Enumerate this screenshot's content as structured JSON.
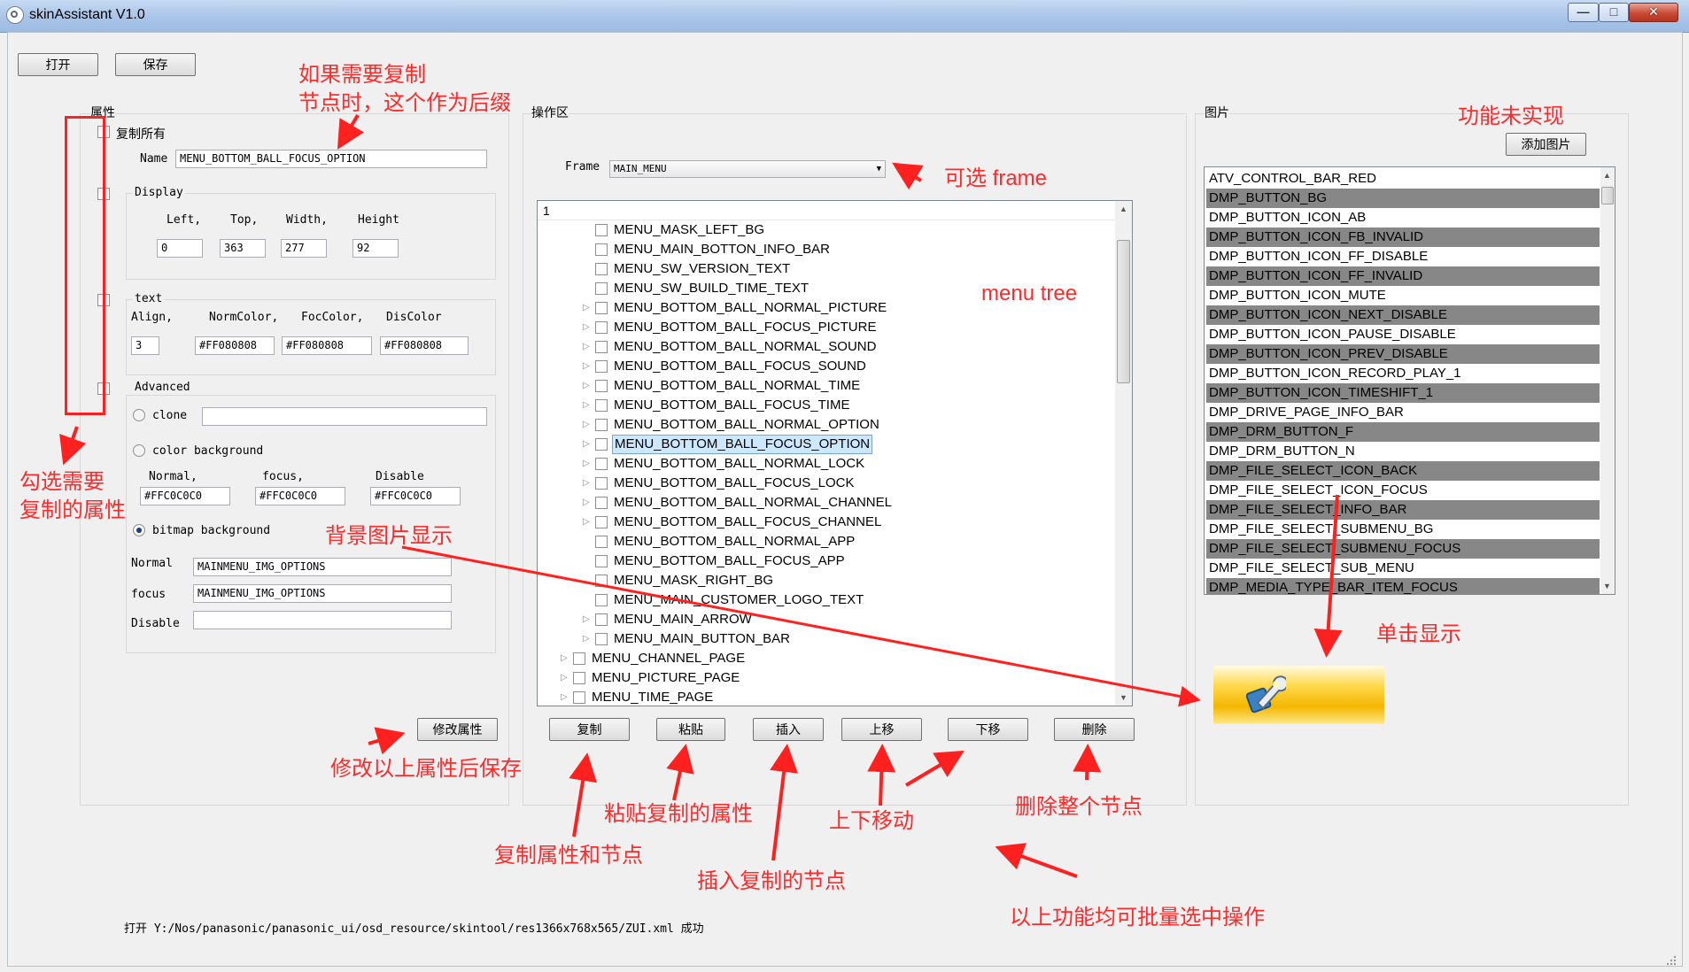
{
  "window": {
    "title": "skinAssistant V1.0",
    "minimize_glyph": "—",
    "maximize_glyph": "□",
    "close_glyph": "✕"
  },
  "toolbar": {
    "open_label": "打开",
    "save_label": "保存"
  },
  "properties": {
    "group_title": "属性",
    "copy_all_label": "复制所有",
    "name_label": "Name",
    "name_value": "MENU_BOTTOM_BALL_FOCUS_OPTION",
    "display": {
      "title": "Display",
      "left_label": "Left,",
      "top_label": "Top,",
      "width_label": "Width,",
      "height_label": "Height",
      "left_value": "0",
      "top_value": "363",
      "width_value": "277",
      "height_value": "92"
    },
    "text": {
      "title": "text",
      "align_label": "Align,",
      "normcolor_label": "NormColor,",
      "foccolor_label": "FocColor,",
      "discolor_label": "DisColor",
      "align_value": "3",
      "normcolor_value": "#FF080808",
      "foccolor_value": "#FF080808",
      "discolor_value": "#FF080808"
    },
    "advanced": {
      "title": "Advanced",
      "clone_label": "clone",
      "clone_value": "",
      "color_bg_label": "color background",
      "normal_label": "Normal,",
      "focus_label": "focus,",
      "disable_label": "Disable",
      "normal_color": "#FFC0C0C0",
      "focus_color": "#FFC0C0C0",
      "disable_color": "#FFC0C0C0",
      "bitmap_bg_label": "bitmap background",
      "bm_normal_label": "Normal",
      "bm_focus_label": "focus",
      "bm_disable_label": "Disable",
      "bm_normal_value": "MAINMENU_IMG_OPTIONS",
      "bm_focus_value": "MAINMENU_IMG_OPTIONS",
      "bm_disable_value": ""
    },
    "modify_button": "修改属性"
  },
  "operation": {
    "group_title": "操作区",
    "frame_label": "Frame",
    "frame_value": "MAIN_MENU",
    "tree_header": "1",
    "tree_items": [
      {
        "label": "MENU_MASK_LEFT_BG",
        "level": 2,
        "expandable": false,
        "selected": false
      },
      {
        "label": "MENU_MAIN_BOTTON_INFO_BAR",
        "level": 2,
        "expandable": false,
        "selected": false
      },
      {
        "label": "MENU_SW_VERSION_TEXT",
        "level": 2,
        "expandable": false,
        "selected": false
      },
      {
        "label": "MENU_SW_BUILD_TIME_TEXT",
        "level": 2,
        "expandable": false,
        "selected": false
      },
      {
        "label": "MENU_BOTTOM_BALL_NORMAL_PICTURE",
        "level": 2,
        "expandable": true,
        "selected": false
      },
      {
        "label": "MENU_BOTTOM_BALL_FOCUS_PICTURE",
        "level": 2,
        "expandable": true,
        "selected": false
      },
      {
        "label": "MENU_BOTTOM_BALL_NORMAL_SOUND",
        "level": 2,
        "expandable": true,
        "selected": false
      },
      {
        "label": "MENU_BOTTOM_BALL_FOCUS_SOUND",
        "level": 2,
        "expandable": true,
        "selected": false
      },
      {
        "label": "MENU_BOTTOM_BALL_NORMAL_TIME",
        "level": 2,
        "expandable": true,
        "selected": false
      },
      {
        "label": "MENU_BOTTOM_BALL_FOCUS_TIME",
        "level": 2,
        "expandable": true,
        "selected": false
      },
      {
        "label": "MENU_BOTTOM_BALL_NORMAL_OPTION",
        "level": 2,
        "expandable": true,
        "selected": false
      },
      {
        "label": "MENU_BOTTOM_BALL_FOCUS_OPTION",
        "level": 2,
        "expandable": true,
        "selected": true
      },
      {
        "label": "MENU_BOTTOM_BALL_NORMAL_LOCK",
        "level": 2,
        "expandable": true,
        "selected": false
      },
      {
        "label": "MENU_BOTTOM_BALL_FOCUS_LOCK",
        "level": 2,
        "expandable": true,
        "selected": false
      },
      {
        "label": "MENU_BOTTOM_BALL_NORMAL_CHANNEL",
        "level": 2,
        "expandable": true,
        "selected": false
      },
      {
        "label": "MENU_BOTTOM_BALL_FOCUS_CHANNEL",
        "level": 2,
        "expandable": true,
        "selected": false
      },
      {
        "label": "MENU_BOTTOM_BALL_NORMAL_APP",
        "level": 2,
        "expandable": false,
        "selected": false
      },
      {
        "label": "MENU_BOTTOM_BALL_FOCUS_APP",
        "level": 2,
        "expandable": false,
        "selected": false
      },
      {
        "label": "MENU_MASK_RIGHT_BG",
        "level": 2,
        "expandable": false,
        "selected": false
      },
      {
        "label": "MENU_MAIN_CUSTOMER_LOGO_TEXT",
        "level": 2,
        "expandable": false,
        "selected": false
      },
      {
        "label": "MENU_MAIN_ARROW",
        "level": 2,
        "expandable": true,
        "selected": false
      },
      {
        "label": "MENU_MAIN_BUTTON_BAR",
        "level": 2,
        "expandable": true,
        "selected": false
      },
      {
        "label": "MENU_CHANNEL_PAGE",
        "level": 1,
        "expandable": true,
        "selected": false
      },
      {
        "label": "MENU_PICTURE_PAGE",
        "level": 1,
        "expandable": true,
        "selected": false
      },
      {
        "label": "MENU_TIME_PAGE",
        "level": 1,
        "expandable": true,
        "selected": false
      }
    ],
    "buttons": {
      "copy": "复制",
      "paste": "粘贴",
      "insert": "插入",
      "move_up": "上移",
      "move_down": "下移",
      "delete": "删除"
    }
  },
  "images": {
    "group_title": "图片",
    "add_button": "添加图片",
    "items": [
      "ATV_CONTROL_BAR_RED",
      "DMP_BUTTON_BG",
      "DMP_BUTTON_ICON_AB",
      "DMP_BUTTON_ICON_FB_INVALID",
      "DMP_BUTTON_ICON_FF_DISABLE",
      "DMP_BUTTON_ICON_FF_INVALID",
      "DMP_BUTTON_ICON_MUTE",
      "DMP_BUTTON_ICON_NEXT_DISABLE",
      "DMP_BUTTON_ICON_PAUSE_DISABLE",
      "DMP_BUTTON_ICON_PREV_DISABLE",
      "DMP_BUTTON_ICON_RECORD_PLAY_1",
      "DMP_BUTTON_ICON_TIMESHIFT_1",
      "DMP_DRIVE_PAGE_INFO_BAR",
      "DMP_DRM_BUTTON_F",
      "DMP_DRM_BUTTON_N",
      "DMP_FILE_SELECT_ICON_BACK",
      "DMP_FILE_SELECT_ICON_FOCUS",
      "DMP_FILE_SELECT_INFO_BAR",
      "DMP_FILE_SELECT_SUBMENU_BG",
      "DMP_FILE_SELECT_SUBMENU_FOCUS",
      "DMP_FILE_SELECT_SUB_MENU",
      "DMP_MEDIA_TYPE_BAR_ITEM_FOCUS"
    ],
    "preview_icon": "wrench-icon"
  },
  "status_text": "打开 Y:/Nos/panasonic/panasonic_ui/osd_resource/skintool/res1366x768x565/ZUI.xml 成功",
  "annotations": {
    "suffix_note_line1": "如果需要复制",
    "suffix_note_line2": "节点时，这个作为后缀",
    "check_note_line1": "勾选需要",
    "check_note_line2": "复制的属性",
    "frame_note": "可选 frame",
    "tree_note": "menu tree",
    "bg_note": "背景图片显示",
    "not_impl_note": "功能未实现",
    "click_note": "单击显示",
    "modify_note": "修改以上属性后保存",
    "copy_note": "复制属性和节点",
    "paste_note": "粘贴复制的属性",
    "insert_note": "插入复制的节点",
    "move_note": "上下移动",
    "delete_note": "删除整个节点",
    "batch_note": "以上功能均可批量选中操作"
  },
  "colors": {
    "annotation_red": "#ff2a2a",
    "selection_blue": "#cce8ff",
    "list_alt_gray": "#878787"
  }
}
